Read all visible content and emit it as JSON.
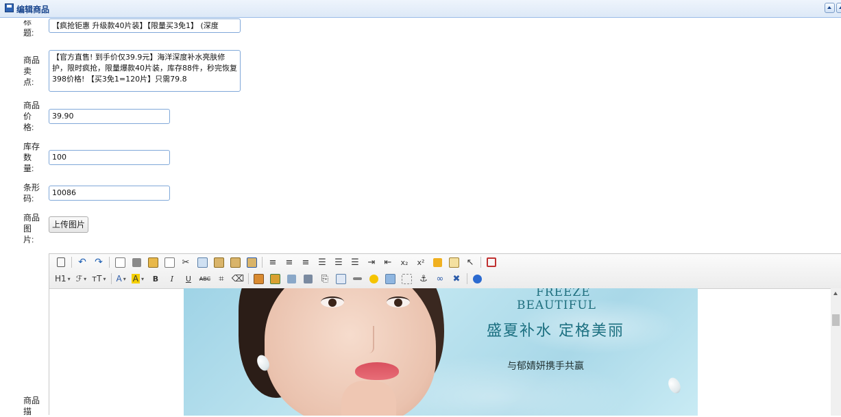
{
  "window": {
    "title": "编辑商品"
  },
  "form": {
    "title_label": "标题:",
    "title_value": "【疯抢钜惠 升级款40片装】【限量买3免1】 (深度",
    "selling_label": "商品卖点:",
    "selling_value": "【官方直售! 到手价仅39.9元】海洋深度补水亮肤修护，限时疯抢，限量爆款40片装，库存88件，秒完恢复398价格! 【买3免1=120片】只需79.8",
    "price_label": "商品价格:",
    "price_value": "39.90",
    "stock_label": "库存数量:",
    "stock_value": "100",
    "barcode_label": "条形码:",
    "barcode_value": "10086",
    "image_label": "商品图片:",
    "upload_button": "上传图片",
    "detail_label": "商品描"
  },
  "toolbar": {
    "heading": "H1",
    "font_family": "ℱ",
    "font_size": "ᴛT",
    "font_color": "A",
    "bg_color": "A",
    "bold": "B",
    "italic": "I",
    "underline": "U",
    "strikethrough": "ABC",
    "subscript": "x₂",
    "superscript": "x²"
  },
  "banner": {
    "en_line1": "FREEZE",
    "en_line2": "BEAUTIFUL",
    "cn_title": "盛夏补水  定格美丽",
    "cn_subtitle": "与郁婧妍携手共赢"
  }
}
